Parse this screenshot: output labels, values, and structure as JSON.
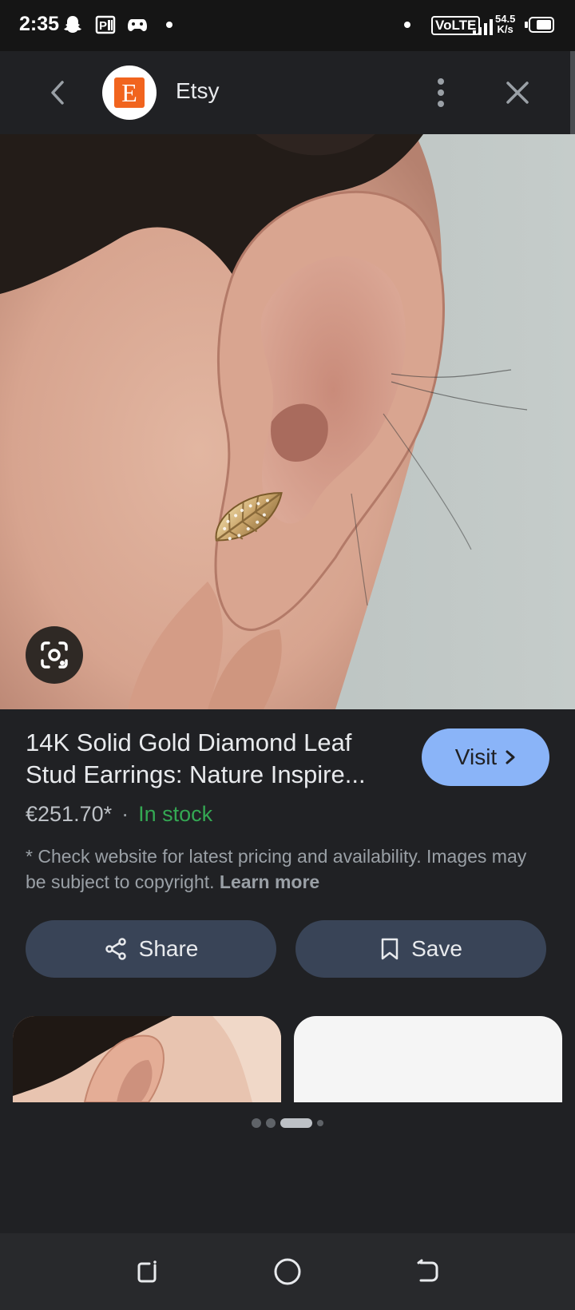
{
  "status_bar": {
    "time": "2:35",
    "network_label": "VoLTE",
    "speed_value": "54.5",
    "speed_unit": "K/s",
    "battery_level": 0.75,
    "icons": [
      "snapchat-icon",
      "parking-app-icon",
      "game-controller-icon",
      "notification-dot",
      "signal-icon",
      "battery-icon"
    ]
  },
  "header": {
    "site_name": "Etsy",
    "logo_letter": "E",
    "brand_color": "#f1641e"
  },
  "product": {
    "title": "14K Solid Gold Diamond Leaf Stud Earrings: Nature Inspire...",
    "price": "€251.70*",
    "separator": "·",
    "availability": "In stock",
    "disclaimer": "* Check website for latest pricing and availability. Images may be subject to copyright.",
    "learn_more": "Learn more",
    "visit_label": "Visit"
  },
  "actions": {
    "share_label": "Share",
    "save_label": "Save"
  },
  "pager": {
    "count": 4,
    "active_index": 2
  },
  "colors": {
    "background": "#202124",
    "accent": "#8ab4f8",
    "in_stock": "#34a853",
    "action_button": "#394457"
  }
}
